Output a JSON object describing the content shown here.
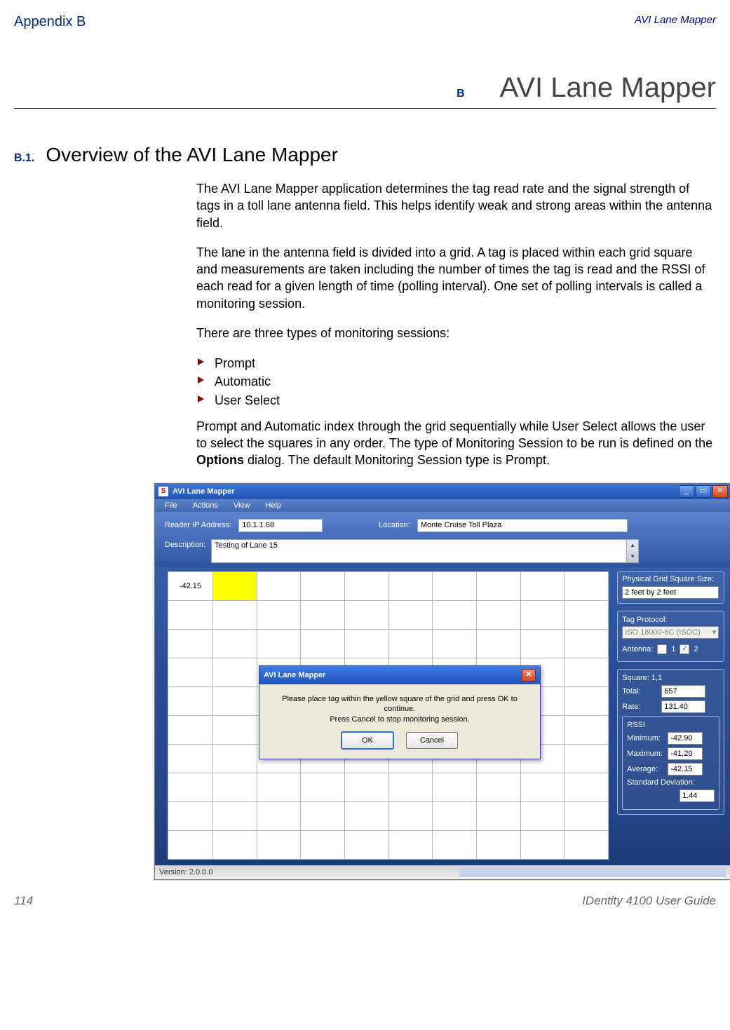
{
  "page": {
    "appendix_label": "Appendix B",
    "header_topic": "AVI Lane Mapper",
    "chapter_letter": "B",
    "chapter_title": "AVI Lane Mapper",
    "section_number": "B.1.",
    "section_title": "Overview of the AVI Lane Mapper",
    "para1": "The AVI Lane Mapper application determines the tag read rate and the signal strength of tags in a toll lane antenna field. This helps identify weak and strong areas within the antenna field.",
    "para2": "The lane in the antenna field is divided into a grid. A tag is placed within each grid square and measurements are taken including the number of times the tag is read and the RSSI of each read for a given length of time (polling interval). One set of polling intervals is called a monitoring session.",
    "para3": "There are three types of monitoring sessions:",
    "bullets": [
      "Prompt",
      "Automatic",
      "User Select"
    ],
    "para4_a": "Prompt and Automatic index through the grid sequentially while User Select allows the user to select the squares in any order. The type of Monitoring Session to be run is defined on the ",
    "para4_bold": "Options",
    "para4_b": " dialog. The default Monitoring Session type is Prompt.",
    "footer_pageno": "114",
    "footer_right": "IDentity 4100 User Guide"
  },
  "scr": {
    "title": "AVI Lane Mapper",
    "menus": [
      "File",
      "Actions",
      "View",
      "Help"
    ],
    "labels": {
      "reader_ip": "Reader IP Address:",
      "location": "Location:",
      "description": "Description:",
      "phys_grid": "Physical Grid Square Size:",
      "tag_protocol": "Tag Protocol:",
      "antenna": "Antenna:",
      "square": "Square: 1,1",
      "total": "Total:",
      "rate": "Rate:",
      "rssi": "RSSI",
      "min": "Minimum:",
      "max": "Maximum:",
      "avg": "Average:",
      "stddev": "Standard Deviation:"
    },
    "values": {
      "reader_ip": "10.1.1.68",
      "location": "Monte Cruise Toll Plaza",
      "description": "Testing of Lane 15",
      "grid_cell_first": "-42.15",
      "phys_grid": "2 feet by 2 feet",
      "tag_protocol": "ISO 18000-6C (ISOC)",
      "antenna1_checked": false,
      "antenna1_label": "1",
      "antenna2_checked": true,
      "antenna2_label": "2",
      "total": "657",
      "rate": "131.40",
      "rssi_min": "-42.90",
      "rssi_max": "-41.20",
      "rssi_avg": "-42.15",
      "rssi_stddev": "1.44"
    },
    "dialog": {
      "title": "AVI Lane Mapper",
      "line1": "Please place tag within the yellow square of the grid and press OK to continue.",
      "line2": "Press Cancel to stop monitoring session.",
      "ok": "OK",
      "cancel": "Cancel"
    },
    "status_version": "Version: 2.0.0.0"
  }
}
